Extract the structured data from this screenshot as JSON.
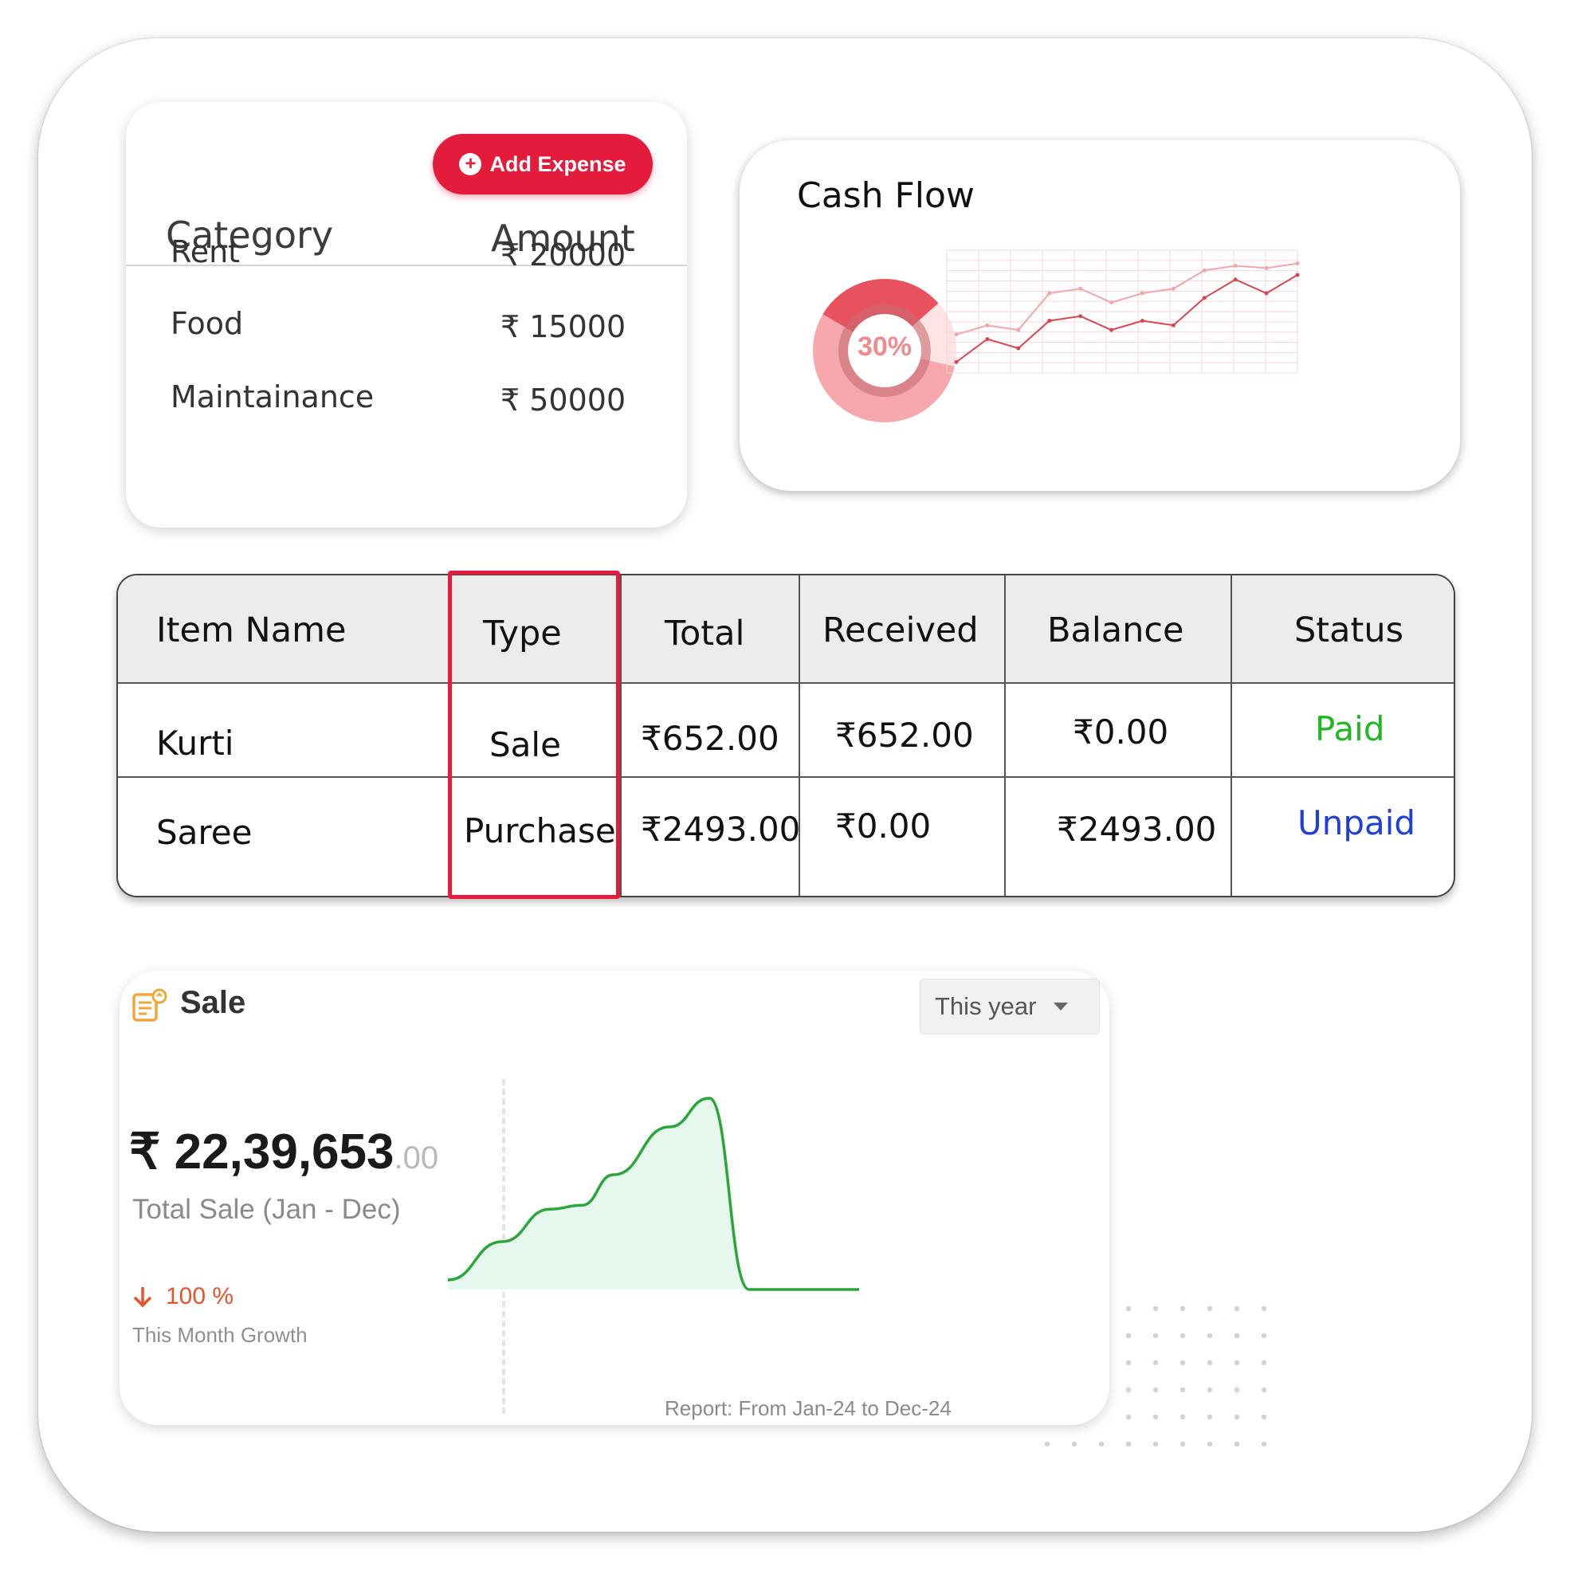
{
  "expense": {
    "add_button": "Add Expense",
    "headers": {
      "category": "Category",
      "amount": "Amount"
    },
    "rows": [
      {
        "category": "Rent",
        "amount": "₹ 20000"
      },
      {
        "category": "Food",
        "amount": "₹ 15000"
      },
      {
        "category": "Maintainance",
        "amount": "₹ 50000"
      }
    ]
  },
  "cash_flow": {
    "title": "Cash Flow",
    "donut_label": "30%",
    "donut_percent": 30,
    "colors": {
      "primary": "#e8525f",
      "light": "#f6a8ad",
      "pale": "#fde3e4"
    },
    "chart_data": {
      "type": "line",
      "series": [
        {
          "values": [
            10,
            60,
            40,
            100,
            110,
            80,
            100,
            90,
            150,
            190,
            160,
            200
          ]
        },
        {
          "values": [
            70,
            90,
            80,
            160,
            170,
            140,
            160,
            170,
            210,
            220,
            215,
            225
          ]
        }
      ]
    }
  },
  "transactions": {
    "headers": [
      "Item Name",
      "Type",
      "Total",
      "Received",
      "Balance",
      "Status"
    ],
    "rows": [
      {
        "item": "Kurti",
        "type": "Sale",
        "total": "₹652.00",
        "received": "₹652.00",
        "balance": "₹0.00",
        "status": "Paid"
      },
      {
        "item": "Saree",
        "type": "Purchase",
        "total": "₹2493.00",
        "received": "₹0.00",
        "balance": "₹2493.00",
        "status": "Unpaid"
      }
    ],
    "status_colors": {
      "Paid": "#22b722",
      "Unpaid": "#1f3fd6"
    },
    "highlight_color": "#e41b3b"
  },
  "sale": {
    "title": "Sale",
    "icon": "invoice-icon",
    "period_select": "This year",
    "amount_main": "₹ 22,39,653",
    "amount_decimal": ".00",
    "caption": "Total Sale (Jan - Dec)",
    "growth_value": "100 %",
    "growth_icon": "arrow-down-icon",
    "growth_caption": "This Month Growth",
    "report_caption": "Report: From Jan-24 to Dec-24",
    "chart_data": {
      "type": "area",
      "values": [
        5,
        25,
        42,
        44,
        60,
        85,
        100,
        0,
        0,
        0,
        0
      ]
    }
  }
}
